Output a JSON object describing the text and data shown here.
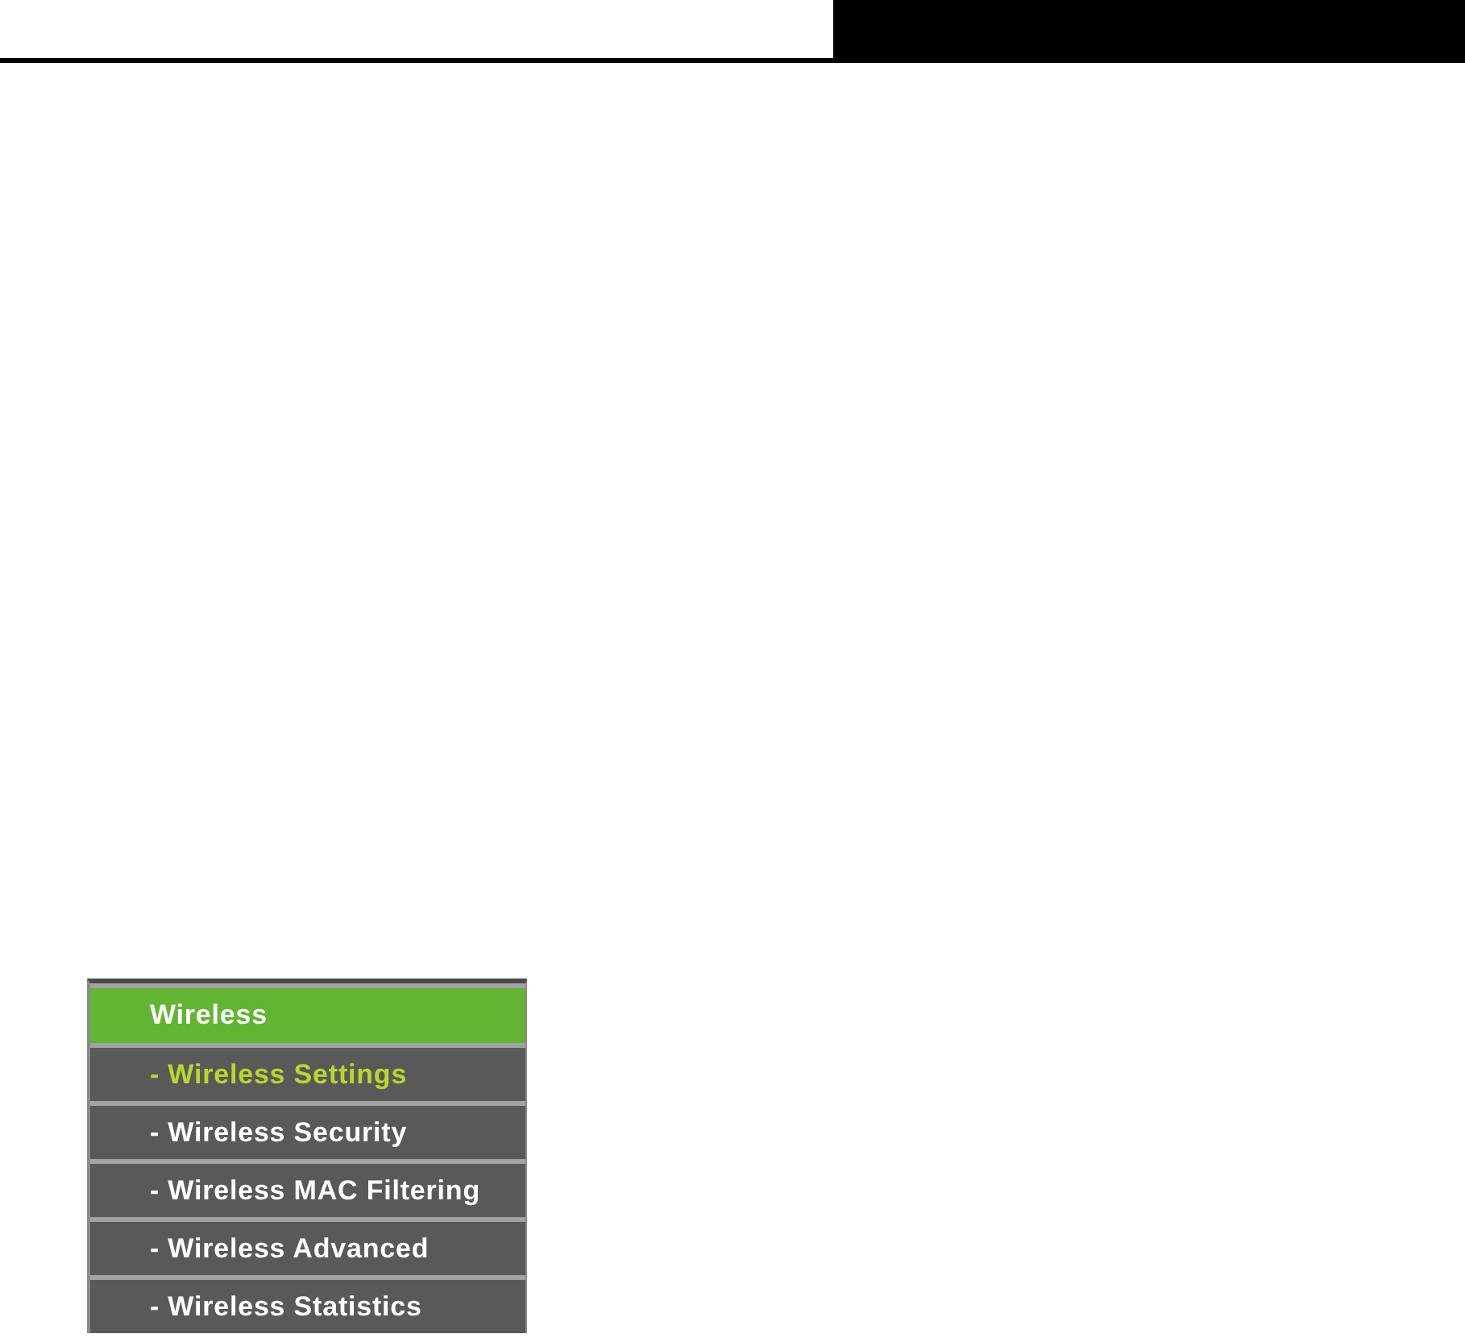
{
  "menu": {
    "title": "Wireless",
    "items": [
      {
        "label": "- Wireless Settings",
        "selected": true
      },
      {
        "label": "- Wireless Security",
        "selected": false
      },
      {
        "label": "- Wireless MAC Filtering",
        "selected": false
      },
      {
        "label": "- Wireless Advanced",
        "selected": false
      },
      {
        "label": "- Wireless Statistics",
        "selected": false
      }
    ]
  }
}
